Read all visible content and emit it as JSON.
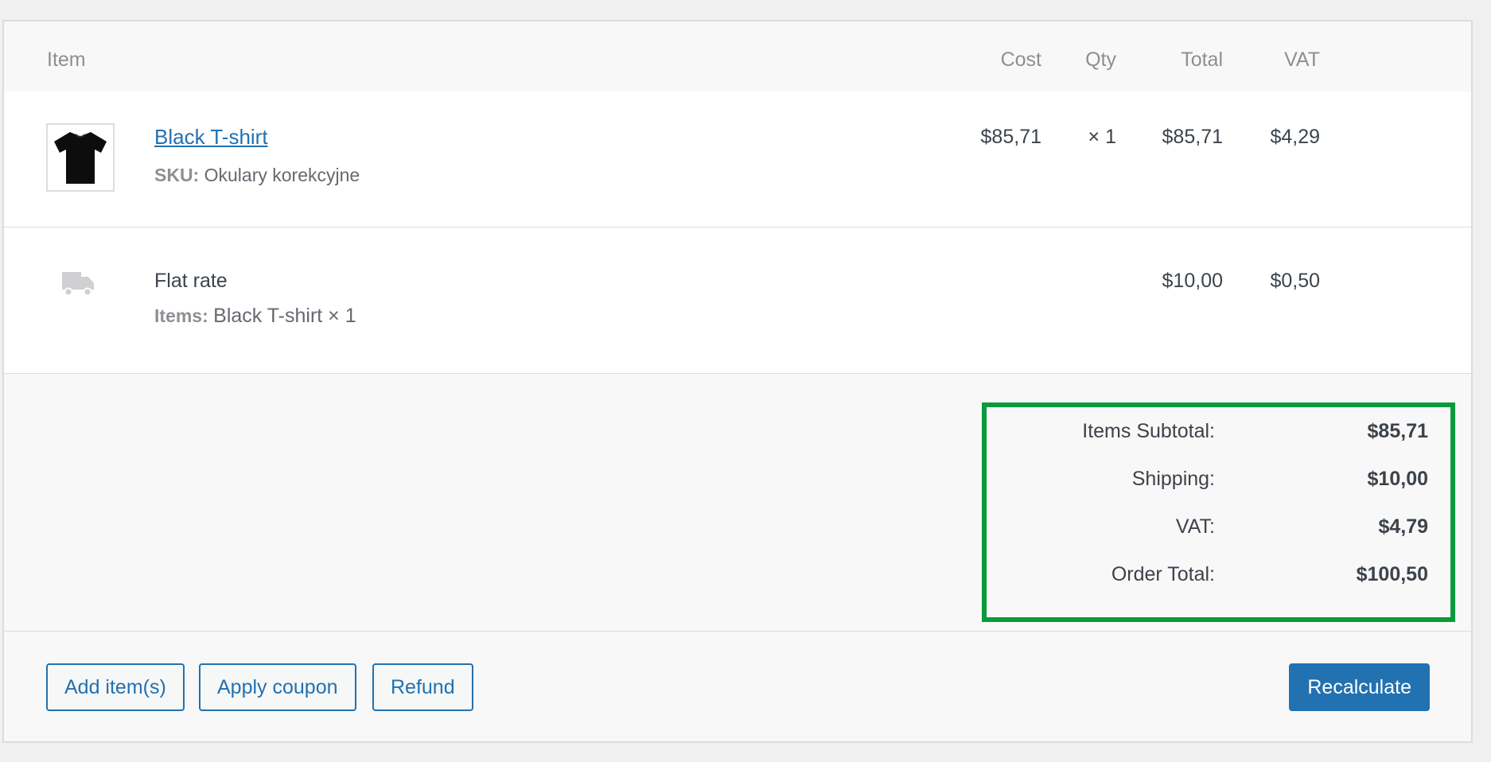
{
  "columns": {
    "item": "Item",
    "cost": "Cost",
    "qty": "Qty",
    "total": "Total",
    "vat": "VAT"
  },
  "product_row": {
    "name": "Black T-shirt",
    "sku_label": "SKU:",
    "sku_value": "Okulary korekcyjne",
    "cost": "$85,71",
    "qty": "× 1",
    "total": "$85,71",
    "vat": "$4,29",
    "thumbnail_icon": "tshirt-icon"
  },
  "shipping_row": {
    "method": "Flat rate",
    "items_label": "Items:",
    "items_value": "Black T-shirt × 1",
    "total": "$10,00",
    "vat": "$0,50",
    "icon": "truck-icon"
  },
  "totals": {
    "items_subtotal_label": "Items Subtotal:",
    "items_subtotal_value": "$85,71",
    "shipping_label": "Shipping:",
    "shipping_value": "$10,00",
    "vat_label": "VAT:",
    "vat_value": "$4,79",
    "order_total_label": "Order Total:",
    "order_total_value": "$100,50",
    "highlight_color": "#0a9a3c"
  },
  "actions": {
    "add_items": "Add item(s)",
    "apply_coupon": "Apply coupon",
    "refund": "Refund",
    "recalculate": "Recalculate"
  },
  "colors": {
    "link": "#2271b1",
    "primary_button": "#2271b1",
    "muted_text": "#8c8f94"
  }
}
